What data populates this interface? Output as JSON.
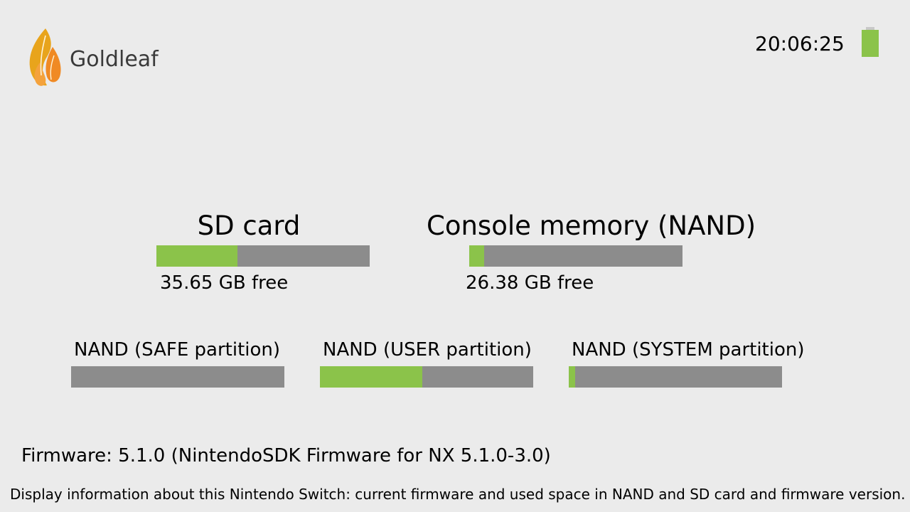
{
  "header": {
    "app_title": "Goldleaf",
    "logo_icon": "flame-leaf-logo-icon",
    "clock": "20:06:25",
    "battery_icon": "battery-icon",
    "battery_level": 1.0
  },
  "storage": {
    "sd_card": {
      "title": "SD card",
      "free_text": "35.65 GB free",
      "used_fraction": 0.38
    },
    "nand": {
      "title": "Console memory (NAND)",
      "free_text": "26.38 GB free",
      "used_fraction": 0.07
    }
  },
  "partitions": [
    {
      "title": "NAND (SAFE partition)",
      "used_fraction": 0.0
    },
    {
      "title": "NAND (USER partition)",
      "used_fraction": 0.48
    },
    {
      "title": "NAND (SYSTEM partition)",
      "used_fraction": 0.03
    }
  ],
  "firmware": "Firmware: 5.1.0 (NintendoSDK Firmware for NX 5.1.0-3.0)",
  "footer_help": "Display information about this Nintendo Switch: current firmware and used space in NAND and SD card and firmware version.",
  "colors": {
    "background": "#ebebeb",
    "bar_used": "#8bc34a",
    "bar_free": "#8c8c8c",
    "logo_orange": "#f08a24",
    "logo_gold": "#e8a41c"
  }
}
